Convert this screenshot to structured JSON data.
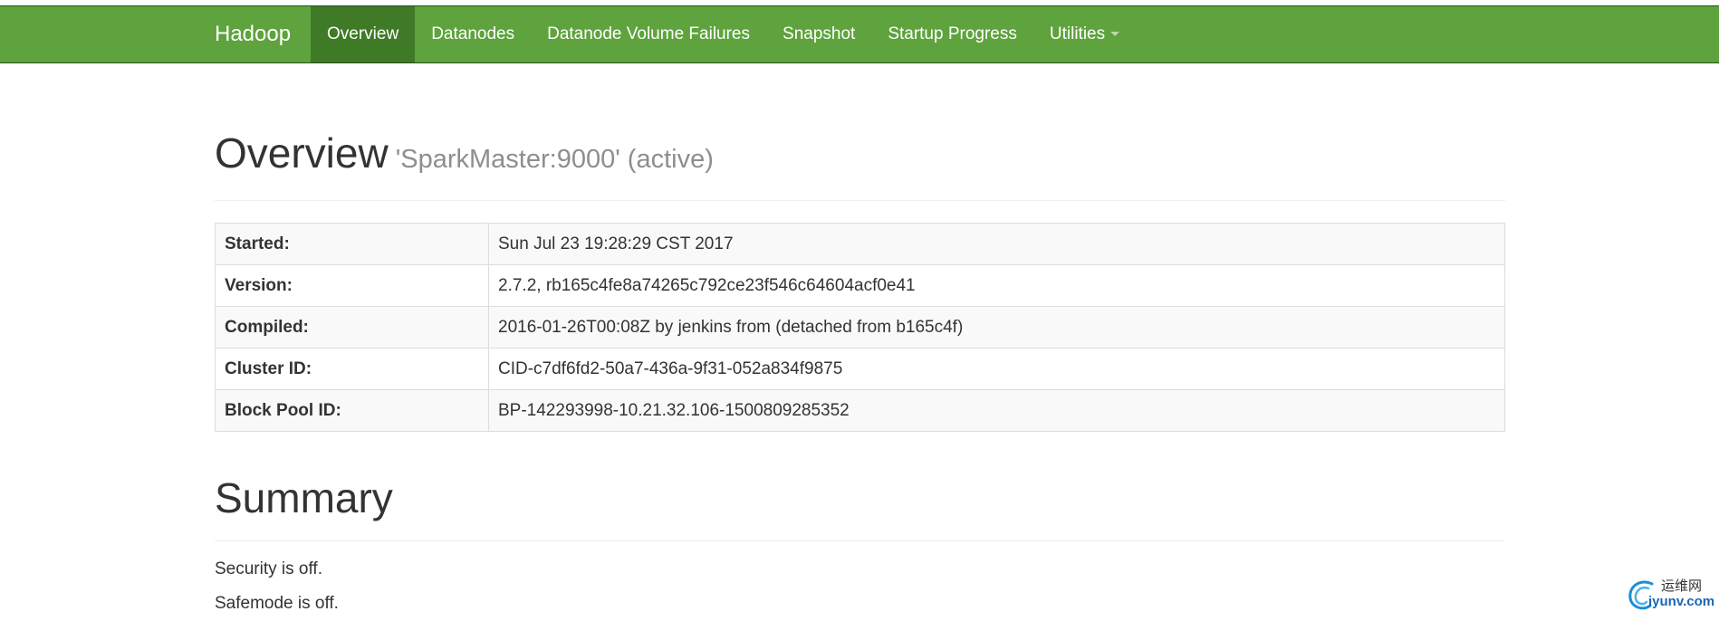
{
  "navbar": {
    "brand": "Hadoop",
    "items": [
      {
        "label": "Overview",
        "active": true
      },
      {
        "label": "Datanodes",
        "active": false
      },
      {
        "label": "Datanode Volume Failures",
        "active": false
      },
      {
        "label": "Snapshot",
        "active": false
      },
      {
        "label": "Startup Progress",
        "active": false
      },
      {
        "label": "Utilities",
        "active": false,
        "dropdown": true
      }
    ],
    "colors": {
      "background": "#5ea33d",
      "active": "#3f7a27"
    }
  },
  "overview": {
    "title": "Overview",
    "subtitle": "'SparkMaster:9000' (active)"
  },
  "info_table": [
    {
      "key": "Started:",
      "value": "Sun Jul 23 19:28:29 CST 2017"
    },
    {
      "key": "Version:",
      "value": "2.7.2, rb165c4fe8a74265c792ce23f546c64604acf0e41"
    },
    {
      "key": "Compiled:",
      "value": "2016-01-26T00:08Z by jenkins from (detached from b165c4f)"
    },
    {
      "key": "Cluster ID:",
      "value": "CID-c7df6fd2-50a7-436a-9f31-052a834f9875"
    },
    {
      "key": "Block Pool ID:",
      "value": "BP-142293998-10.21.32.106-1500809285352"
    }
  ],
  "summary": {
    "title": "Summary",
    "security": "Security is off.",
    "safemode": "Safemode is off."
  },
  "watermark": {
    "name": "运维网",
    "url": "iyunv.com",
    "icon": "swirl-logo-icon"
  }
}
